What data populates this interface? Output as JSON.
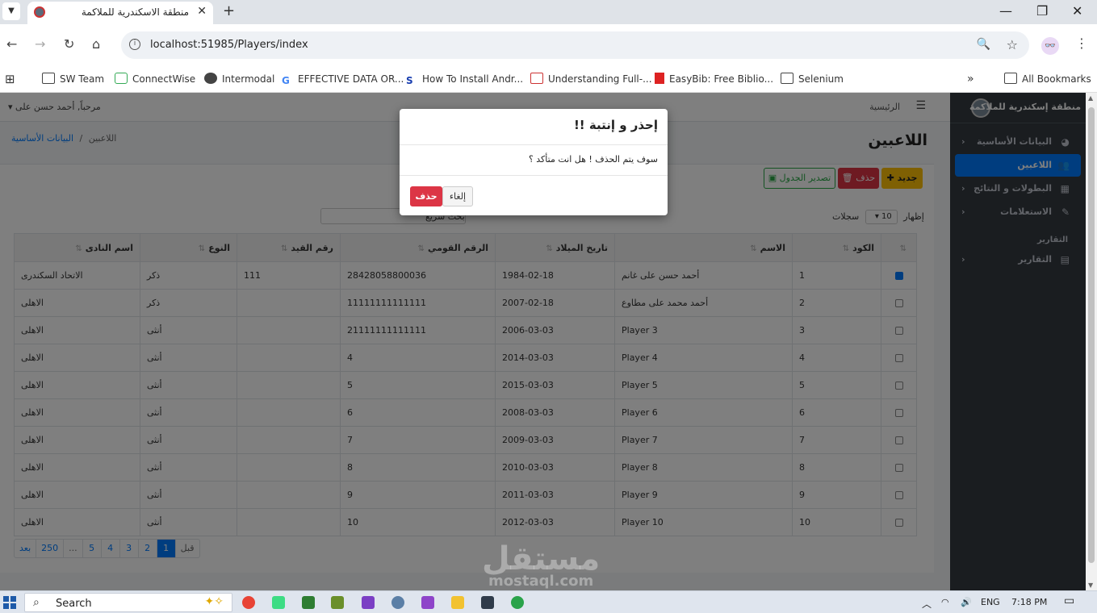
{
  "browser": {
    "tab_title": "منطقة الاسكندرية للملاكمة",
    "url": "localhost:51985/Players/index",
    "bookmarks": [
      "SW Team",
      "ConnectWise",
      "Intermodal",
      "EFFECTIVE DATA OR...",
      "How To Install Andr...",
      "Understanding Full-...",
      "EasyBib: Free Biblio...",
      "Selenium"
    ],
    "all_bookmarks": "All Bookmarks"
  },
  "topnav": {
    "welcome": "مرحباً, أحمد حسن على",
    "home": "الرئيسية"
  },
  "sidebar": {
    "brand": "منطقة إسكندرية للملاكمة",
    "items": [
      {
        "label": "البيانات الأساسية",
        "icon": "dashboard-icon",
        "active": false
      },
      {
        "label": "اللاعبين",
        "icon": "users-icon",
        "active": true
      },
      {
        "label": "البطولات و النتائج",
        "icon": "table-icon",
        "active": false
      },
      {
        "label": "الاستعلامات",
        "icon": "edit-icon",
        "active": false
      }
    ],
    "header_reports": "التقارير",
    "reports_item": "التقارير"
  },
  "page": {
    "title": "اللاعبين",
    "breadcrumb_parent": "البيانات الأساسية",
    "breadcrumb_sep": "/",
    "breadcrumb_current": "اللاعبين"
  },
  "toolbar": {
    "new_label": "جديد",
    "delete_label": "حذف",
    "export_label": "تصدير الجدول"
  },
  "listing": {
    "show_label": "إظهار",
    "page_size": "10",
    "records_label": "سجلات",
    "search_label": "بحث سريع"
  },
  "table": {
    "headers": [
      "",
      "الكود",
      "الاسم",
      "تاريخ الميلاد",
      "الرقم القومي",
      "رقم القيد",
      "النوع",
      "اسم النادى"
    ],
    "rows": [
      {
        "checked": true,
        "code": "1",
        "name": "أحمد حسن على غانم",
        "dob": "1984-02-18",
        "nid": "28428058800036",
        "reg": "111",
        "gender": "ذكر",
        "club": "الاتحاد السكندرى"
      },
      {
        "checked": false,
        "code": "2",
        "name": "أحمد محمد على مطاوع",
        "dob": "2007-02-18",
        "nid": "11111111111111",
        "reg": "",
        "gender": "ذكر",
        "club": "الاهلى"
      },
      {
        "checked": false,
        "code": "3",
        "name": "Player 3",
        "dob": "2006-03-03",
        "nid": "21111111111111",
        "reg": "",
        "gender": "أنثى",
        "club": "الاهلى"
      },
      {
        "checked": false,
        "code": "4",
        "name": "Player 4",
        "dob": "2014-03-03",
        "nid": "4",
        "reg": "",
        "gender": "أنثى",
        "club": "الاهلى"
      },
      {
        "checked": false,
        "code": "5",
        "name": "Player 5",
        "dob": "2015-03-03",
        "nid": "5",
        "reg": "",
        "gender": "أنثى",
        "club": "الاهلى"
      },
      {
        "checked": false,
        "code": "6",
        "name": "Player 6",
        "dob": "2008-03-03",
        "nid": "6",
        "reg": "",
        "gender": "أنثى",
        "club": "الاهلى"
      },
      {
        "checked": false,
        "code": "7",
        "name": "Player 7",
        "dob": "2009-03-03",
        "nid": "7",
        "reg": "",
        "gender": "أنثى",
        "club": "الاهلى"
      },
      {
        "checked": false,
        "code": "8",
        "name": "Player 8",
        "dob": "2010-03-03",
        "nid": "8",
        "reg": "",
        "gender": "أنثى",
        "club": "الاهلى"
      },
      {
        "checked": false,
        "code": "9",
        "name": "Player 9",
        "dob": "2011-03-03",
        "nid": "9",
        "reg": "",
        "gender": "أنثى",
        "club": "الاهلى"
      },
      {
        "checked": false,
        "code": "10",
        "name": "Player 10",
        "dob": "2012-03-03",
        "nid": "10",
        "reg": "",
        "gender": "أنثى",
        "club": "الاهلى"
      }
    ]
  },
  "pager": [
    "بعد",
    "250",
    "...",
    "5",
    "4",
    "3",
    "2",
    "1",
    "قبل"
  ],
  "pager_active": "1",
  "modal": {
    "title": "إحذر و إنتبة !!",
    "message": "سوف يتم الحذف ! هل انت متأكد ؟",
    "cancel_label": "إلغاء",
    "confirm_label": "حذف"
  },
  "watermark": {
    "main": "مستقل",
    "sub": "mostaql.com"
  },
  "taskbar": {
    "search_label": "Search",
    "lang": "ENG",
    "time": "7:18 PM"
  },
  "colors": {
    "primary": "#007bff",
    "danger": "#dc3545",
    "warning": "#ffc107",
    "success": "#28a745",
    "sidebar": "#343a40"
  }
}
